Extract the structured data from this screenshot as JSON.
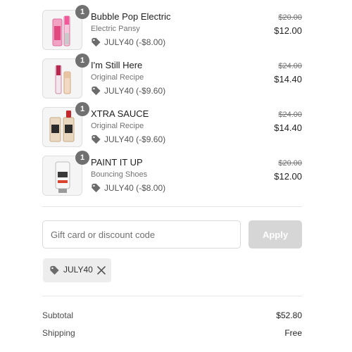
{
  "line_items": [
    {
      "name": "Bubble Pop Electric",
      "variant": "Electric Pansy",
      "quantity": "1",
      "discount": "JULY40 (-$8.00)",
      "original_price": "$20.00",
      "final_price": "$12.00",
      "thumbnail": "lip-gloss-pink"
    },
    {
      "name": "I'm Still Here",
      "variant": "Original Recipe",
      "quantity": "1",
      "discount": "JULY40 (-$9.60)",
      "original_price": "$24.00",
      "final_price": "$14.40",
      "thumbnail": "lip-gloss-pair"
    },
    {
      "name": "XTRA SAUCE",
      "variant": "Original Recipe",
      "quantity": "1",
      "discount": "JULY40 (-$9.60)",
      "original_price": "$24.00",
      "final_price": "$14.40",
      "thumbnail": "sauce-bottles"
    },
    {
      "name": "PAINT IT UP",
      "variant": "Bouncing Shoes",
      "quantity": "1",
      "discount": "JULY40 (-$8.00)",
      "original_price": "$20.00",
      "final_price": "$12.00",
      "thumbnail": "paint-tube"
    }
  ],
  "discount_form": {
    "placeholder": "Gift card or discount code",
    "apply_label": "Apply"
  },
  "applied_code": {
    "code": "JULY40"
  },
  "summary": {
    "subtotal_label": "Subtotal",
    "subtotal_value": "$52.80",
    "shipping_label": "Shipping",
    "shipping_value": "Free"
  },
  "icons": {
    "tag": "tag-icon",
    "remove": "close-icon"
  },
  "colors": {
    "badge": "#707070",
    "apply_disabled": "#d6d6d6",
    "chip_bg": "#ededed",
    "divider": "#e6e6e6"
  }
}
